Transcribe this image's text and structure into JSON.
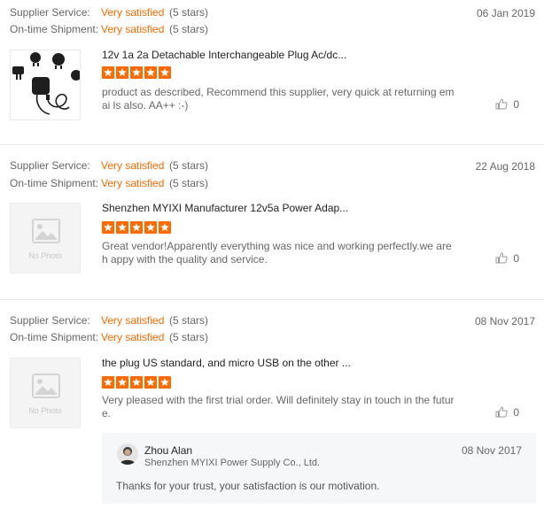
{
  "labels": {
    "supplier_service": "Supplier Service:",
    "ontime_shipment": "On-time Shipment:"
  },
  "colors": {
    "accent": "#ff6a00",
    "separator": "#e6e6e6"
  },
  "reviews": [
    {
      "supplier_value": "Very satisfied",
      "supplier_stars": "(5 stars)",
      "shipment_value": "Very satisfied",
      "shipment_stars": "(5 stars)",
      "date": "06 Jan 2019",
      "product_title": "12v 1a 2a Detachable Interchangeable Plug Ac/dc...",
      "rating": 5,
      "text": "product as described, Recommend this supplier, very quick at returning emai ls also. AA++ :-)",
      "likes": "0",
      "thumbnail": "product-photo"
    },
    {
      "supplier_value": "Very satisfied",
      "supplier_stars": "(5 stars)",
      "shipment_value": "Very satisfied",
      "shipment_stars": "(5 stars)",
      "date": "22 Aug 2018",
      "product_title": "Shenzhen MYIXI Manufacturer 12v5a Power Adap...",
      "rating": 5,
      "text": "Great vendor!Apparently everything was nice and working perfectly.we are h appy with the quality and service.",
      "likes": "0",
      "thumbnail": "No Photo"
    },
    {
      "supplier_value": "Very satisfied",
      "supplier_stars": "(5 stars)",
      "shipment_value": "Very satisfied",
      "shipment_stars": "(5 stars)",
      "date": "08 Nov 2017",
      "product_title": "the plug US standard, and micro USB on the other ...",
      "rating": 5,
      "text": "Very pleased with the first trial order. Will definitely stay in touch in the futur e.",
      "likes": "0",
      "thumbnail": "No Photo",
      "reply": {
        "name": "Zhou Alan",
        "company": "Shenzhen MYIXI Power Supply Co., Ltd.",
        "date": "08 Nov 2017",
        "text": "Thanks for your trust, your satisfaction is our motivation."
      }
    }
  ]
}
